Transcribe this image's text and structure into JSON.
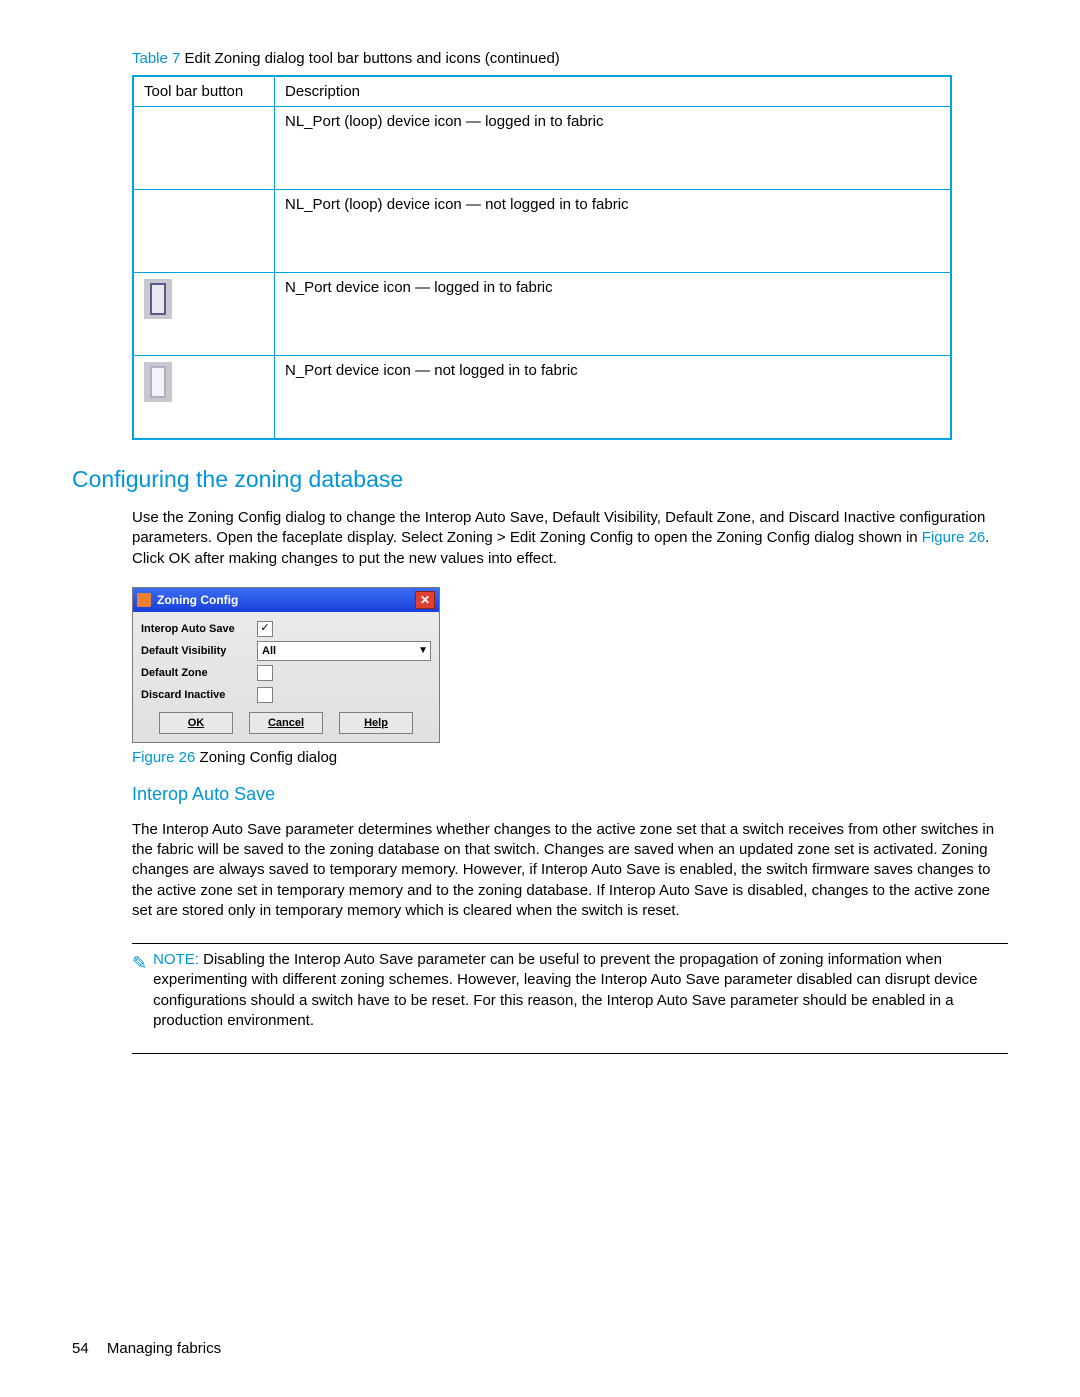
{
  "table": {
    "caption_label": "Table 7",
    "caption_rest": "Edit Zoning dialog tool bar buttons and icons (continued)",
    "headers": {
      "c1": "Tool bar button",
      "c2": "Description"
    },
    "rows": [
      {
        "desc": "NL_Port (loop) device icon — logged in to fabric"
      },
      {
        "desc": "NL_Port (loop) device icon — not logged in to fabric"
      },
      {
        "desc": "N_Port device icon — logged in to fabric"
      },
      {
        "desc": "N_Port device icon — not logged in to fabric"
      }
    ]
  },
  "section1": {
    "heading": "Configuring the zoning database",
    "para_a": "Use the Zoning Config dialog to change the Interop Auto Save, Default Visibility, Default Zone, and Discard Inactive configuration parameters. Open the faceplate display. Select Zoning > Edit Zoning Config to open the Zoning Config dialog shown in ",
    "fig_link": "Figure 26",
    "para_b": ". Click OK after making changes to put the new values into effect."
  },
  "dialog": {
    "title": "Zoning Config",
    "rows": {
      "interop": {
        "label": "Interop Auto Save",
        "checked": true
      },
      "visibility": {
        "label": "Default Visibility",
        "value": "All"
      },
      "zone": {
        "label": "Default Zone",
        "checked": false
      },
      "discard": {
        "label": "Discard Inactive",
        "checked": false
      }
    },
    "buttons": {
      "ok": "OK",
      "cancel": "Cancel",
      "help": "Help"
    }
  },
  "figure": {
    "num": "Figure 26",
    "text": " Zoning Config dialog"
  },
  "section2": {
    "heading": "Interop Auto Save",
    "para": "The Interop Auto Save parameter determines whether changes to the active zone set that a switch receives from other switches in the fabric will be saved to the zoning database on that switch. Changes are saved when an updated zone set is activated. Zoning changes are always saved to temporary memory. However, if Interop Auto Save is enabled, the switch firmware saves changes to the active zone set in temporary memory and to the zoning database. If Interop Auto Save is disabled, changes to the active zone set are stored only in temporary memory which is cleared when the switch is reset."
  },
  "note": {
    "label": "NOTE:",
    "text": "Disabling the Interop Auto Save parameter can be useful to prevent the propagation of zoning information when experimenting with different zoning schemes. However, leaving the Interop Auto Save parameter disabled can disrupt device configurations should a switch have to be reset. For this reason, the Interop Auto Save parameter should be enabled in a production environment."
  },
  "footer": {
    "page": "54",
    "chapter": "Managing fabrics"
  }
}
